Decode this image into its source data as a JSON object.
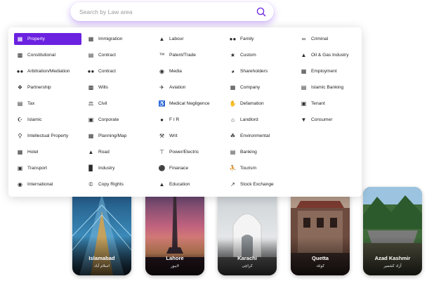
{
  "search": {
    "placeholder": "Search by Law area",
    "value": ""
  },
  "accent_color": "#6b21e0",
  "categories": [
    [
      {
        "label": "Property",
        "icon": "building-icon",
        "active": true
      },
      {
        "label": "Constitutional",
        "icon": "book-icon"
      },
      {
        "label": "Arbitration/Mediation",
        "icon": "group-icon"
      },
      {
        "label": "Partnership",
        "icon": "handshake-icon"
      },
      {
        "label": "Tax",
        "icon": "receipt-icon"
      },
      {
        "label": "Islamic",
        "icon": "crescent-star-icon"
      },
      {
        "label": "Intellectual Property",
        "icon": "lightbulb-icon"
      },
      {
        "label": "Hotel",
        "icon": "hotel-icon"
      },
      {
        "label": "Transport",
        "icon": "bus-icon"
      },
      {
        "label": "International",
        "icon": "globe-icon"
      }
    ],
    [
      {
        "label": "Immigration",
        "icon": "passport-icon"
      },
      {
        "label": "Contract",
        "icon": "contract-icon"
      },
      {
        "label": "Contract",
        "icon": "people-icon"
      },
      {
        "label": "Wills",
        "icon": "will-document-icon"
      },
      {
        "label": "Civil",
        "icon": "scales-icon"
      },
      {
        "label": "Corporate",
        "icon": "briefcase-icon"
      },
      {
        "label": "Planning/Map",
        "icon": "map-icon"
      },
      {
        "label": "Road",
        "icon": "road-icon"
      },
      {
        "label": "Industry",
        "icon": "factory-icon"
      },
      {
        "label": "Copy Rights",
        "icon": "copyright-icon"
      }
    ],
    [
      {
        "label": "Labour",
        "icon": "hard-hat-icon"
      },
      {
        "label": "Patent/Trade",
        "icon": "trademark-icon"
      },
      {
        "label": "Media",
        "icon": "video-camera-icon"
      },
      {
        "label": "Aviation",
        "icon": "airplane-icon"
      },
      {
        "label": "Medical Negligence",
        "icon": "wheelchair-icon"
      },
      {
        "label": "F I R",
        "icon": "police-officer-icon"
      },
      {
        "label": "Writ",
        "icon": "gavel-icon"
      },
      {
        "label": "Power/Electric",
        "icon": "power-pylon-icon"
      },
      {
        "label": "Finanace",
        "icon": "money-bag-icon"
      },
      {
        "label": "Education",
        "icon": "graduation-cap-icon"
      }
    ],
    [
      {
        "label": "Family",
        "icon": "family-icon"
      },
      {
        "label": "Custom",
        "icon": "customs-icon"
      },
      {
        "label": "Shareholders",
        "icon": "pie-chart-icon"
      },
      {
        "label": "Company",
        "icon": "company-building-icon"
      },
      {
        "label": "Defamation",
        "icon": "hand-stop-icon"
      },
      {
        "label": "Landlord",
        "icon": "house-icon"
      },
      {
        "label": "Environmental",
        "icon": "environment-icon"
      },
      {
        "label": "Banking",
        "icon": "bank-icon"
      },
      {
        "label": "Tourism",
        "icon": "hiker-icon"
      },
      {
        "label": "Stock Exchange",
        "icon": "trend-up-icon"
      }
    ],
    [
      {
        "label": "Criminal",
        "icon": "handcuffs-icon"
      },
      {
        "label": "Oil & Gas Industry",
        "icon": "oil-rig-icon"
      },
      {
        "label": "Employment",
        "icon": "id-badge-icon"
      },
      {
        "label": "Islamic Banking",
        "icon": "islamic-bank-icon"
      },
      {
        "label": "Tenant",
        "icon": "tenant-card-icon"
      },
      {
        "label": "Consumer",
        "icon": "shopping-basket-icon"
      }
    ]
  ],
  "cities": [
    {
      "name": "Islamabad",
      "urdu": "اسلام آباد"
    },
    {
      "name": "Lahore",
      "urdu": "لاہور"
    },
    {
      "name": "Karachi",
      "urdu": "کراچی"
    },
    {
      "name": "Quetta",
      "urdu": "کوئٹہ"
    },
    {
      "name": "Azad Kashmir",
      "urdu": "آزاد کشمیر"
    }
  ]
}
